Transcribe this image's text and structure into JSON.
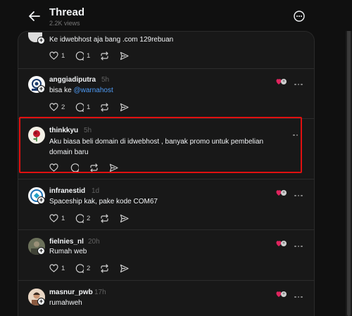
{
  "header": {
    "title": "Thread",
    "subtitle": "2.2K views"
  },
  "posts": [
    {
      "username": "",
      "time": "",
      "text": "Ke idwebhost aja bang .com 129rebuan",
      "likes": "1",
      "replies": "1",
      "reposts": "",
      "avatar_icon": "avatar-stack-icon"
    },
    {
      "username": "anggiadiputra",
      "time": "5h",
      "text_prefix": "bisa ke ",
      "mention": "@warnahost",
      "likes": "2",
      "replies": "1",
      "reposts": "",
      "avatar_icon": "logo-avatar-icon"
    },
    {
      "username": "thinkkyu",
      "time": "5h",
      "text": "Aku biasa beli domain di idwebhost , banyak promo untuk pembelian domain baru",
      "likes": "",
      "replies": "",
      "reposts": "",
      "avatar_icon": "rose-avatar-icon"
    },
    {
      "username": "infranestid",
      "time": "1d",
      "text": "Spaceship kak, pake kode COM67",
      "likes": "1",
      "replies": "2",
      "reposts": "",
      "avatar_icon": "logo-avatar-icon"
    },
    {
      "username": "fielnies_nl",
      "time": "20h",
      "text": "Rumah web",
      "likes": "1",
      "replies": "2",
      "reposts": "",
      "avatar_icon": "photo-avatar-icon"
    },
    {
      "username": "masnur_pwb",
      "time": "17h",
      "text": "rumahweh",
      "likes": "",
      "replies": "",
      "reposts": "",
      "avatar_icon": "person-avatar-icon"
    }
  ],
  "colors": {
    "background": "#101010",
    "panel": "#181818",
    "mention": "#4f9cf7",
    "highlight": "#e01010",
    "like_badge": "#e0245e"
  }
}
